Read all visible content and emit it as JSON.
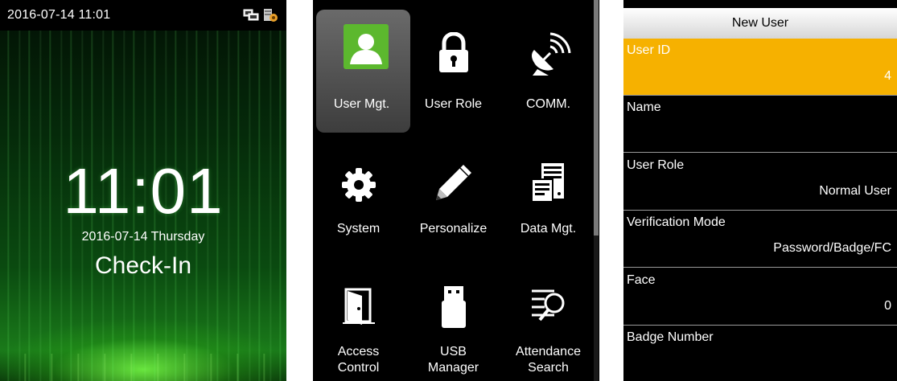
{
  "standby": {
    "status_time": "2016-07-14 11:01",
    "clock": "11:01",
    "date_line": "2016-07-14  Thursday",
    "state": "Check-In",
    "status_icons": [
      "network-icon",
      "server-icon"
    ]
  },
  "menu": {
    "items": [
      {
        "icon": "user-icon",
        "lines": [
          "User Mgt."
        ],
        "selected": true
      },
      {
        "icon": "lock-icon",
        "lines": [
          "User Role"
        ],
        "selected": false
      },
      {
        "icon": "satellite-dish-icon",
        "lines": [
          "COMM."
        ],
        "selected": false
      },
      {
        "icon": "gear-icon",
        "lines": [
          "System"
        ],
        "selected": false
      },
      {
        "icon": "pencil-icon",
        "lines": [
          "Personalize"
        ],
        "selected": false
      },
      {
        "icon": "data-server-icon",
        "lines": [
          "Data Mgt."
        ],
        "selected": false
      },
      {
        "icon": "door-icon",
        "lines": [
          "Access",
          "Control"
        ],
        "selected": false
      },
      {
        "icon": "usb-drive-icon",
        "lines": [
          "USB",
          "Manager"
        ],
        "selected": false
      },
      {
        "icon": "attendance-search-icon",
        "lines": [
          "Attendance",
          "Search"
        ],
        "selected": false
      }
    ],
    "scrollbar_fraction": 0.62
  },
  "new_user": {
    "title": "New User",
    "fields": [
      {
        "label": "User ID",
        "value": "4",
        "selected": true
      },
      {
        "label": "Name",
        "value": "",
        "selected": false
      },
      {
        "label": "User Role",
        "value": "Normal User",
        "selected": false
      },
      {
        "label": "Verification Mode",
        "value": "Password/Badge/FC",
        "selected": false
      },
      {
        "label": "Face",
        "value": "0",
        "selected": false
      },
      {
        "label": "Badge Number",
        "value": "",
        "selected": false
      }
    ]
  },
  "colors": {
    "highlight": "#f6b100",
    "user_icon_bg": "#5cb82e",
    "menu_bg": "#000000"
  }
}
